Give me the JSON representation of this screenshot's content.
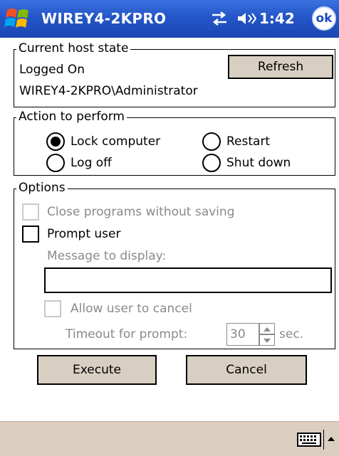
{
  "titlebar": {
    "title": "WIREY4-2KPRO",
    "time": "1:42",
    "ok_label": "ok"
  },
  "host_state": {
    "legend": "Current host state",
    "status": "Logged On",
    "refresh_label": "Refresh",
    "user": "WIREY4-2KPRO\\Administrator"
  },
  "action": {
    "legend": "Action to perform",
    "options": [
      {
        "label": "Lock computer",
        "selected": true
      },
      {
        "label": "Restart",
        "selected": false
      },
      {
        "label": "Log off",
        "selected": false
      },
      {
        "label": "Shut down",
        "selected": false
      }
    ]
  },
  "options": {
    "legend": "Options",
    "close_programs_label": "Close programs without saving",
    "prompt_user_label": "Prompt user",
    "message_label": "Message to display:",
    "message_value": "",
    "allow_cancel_label": "Allow user to cancel",
    "timeout_label": "Timeout for prompt:",
    "timeout_value": "30",
    "timeout_unit": "sec."
  },
  "buttons": {
    "execute": "Execute",
    "cancel": "Cancel"
  },
  "icons": {
    "start": "windows-flag-icon",
    "connectivity": "connectivity-icon",
    "volume": "speaker-icon",
    "keyboard": "keyboard-icon"
  },
  "colors": {
    "titlebar": "#2456c8",
    "button_face": "#d8cfc2",
    "menubar": "#dccfc0",
    "disabled_text": "#8a8a8a"
  }
}
